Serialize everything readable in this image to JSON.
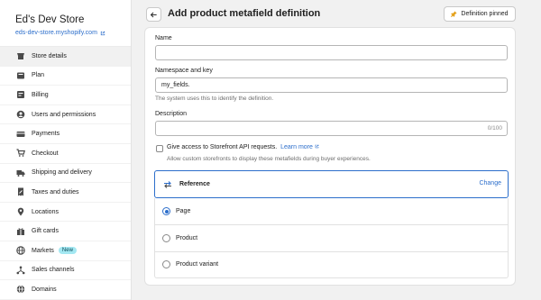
{
  "store": {
    "name": "Ed's Dev Store",
    "url": "eds-dev-store.myshopify.com"
  },
  "sidebar": {
    "items": [
      {
        "label": "Store details",
        "icon": "store-icon",
        "active": true
      },
      {
        "label": "Plan",
        "icon": "plan-icon"
      },
      {
        "label": "Billing",
        "icon": "billing-icon"
      },
      {
        "label": "Users and permissions",
        "icon": "user-icon"
      },
      {
        "label": "Payments",
        "icon": "payments-icon"
      },
      {
        "label": "Checkout",
        "icon": "cart-icon"
      },
      {
        "label": "Shipping and delivery",
        "icon": "truck-icon"
      },
      {
        "label": "Taxes and duties",
        "icon": "receipt-icon"
      },
      {
        "label": "Locations",
        "icon": "location-icon"
      },
      {
        "label": "Gift cards",
        "icon": "gift-icon"
      },
      {
        "label": "Markets",
        "icon": "globe-icon",
        "badge": "New"
      },
      {
        "label": "Sales channels",
        "icon": "channels-icon"
      },
      {
        "label": "Domains",
        "icon": "domain-icon"
      }
    ]
  },
  "header": {
    "title": "Add product metafield definition",
    "pin_label": "Definition pinned"
  },
  "form": {
    "name_label": "Name",
    "name_value": "",
    "namespace_label": "Namespace and key",
    "namespace_value": "my_fields.",
    "namespace_help": "The system uses this to identify the definition.",
    "description_label": "Description",
    "description_value": "",
    "description_counter": "0/100",
    "storefront_label": "Give access to Storefront API requests.",
    "learn_more": "Learn more",
    "storefront_help": "Allow custom storefronts to display these metafields during buyer experiences.",
    "storefront_checked": false
  },
  "type_selector": {
    "label": "Reference",
    "change_label": "Change",
    "options": [
      {
        "label": "Page",
        "selected": true
      },
      {
        "label": "Product",
        "selected": false
      },
      {
        "label": "Product variant",
        "selected": false
      }
    ]
  },
  "colors": {
    "accent": "#2c6ecb",
    "badge_bg": "#a4e8f2"
  }
}
